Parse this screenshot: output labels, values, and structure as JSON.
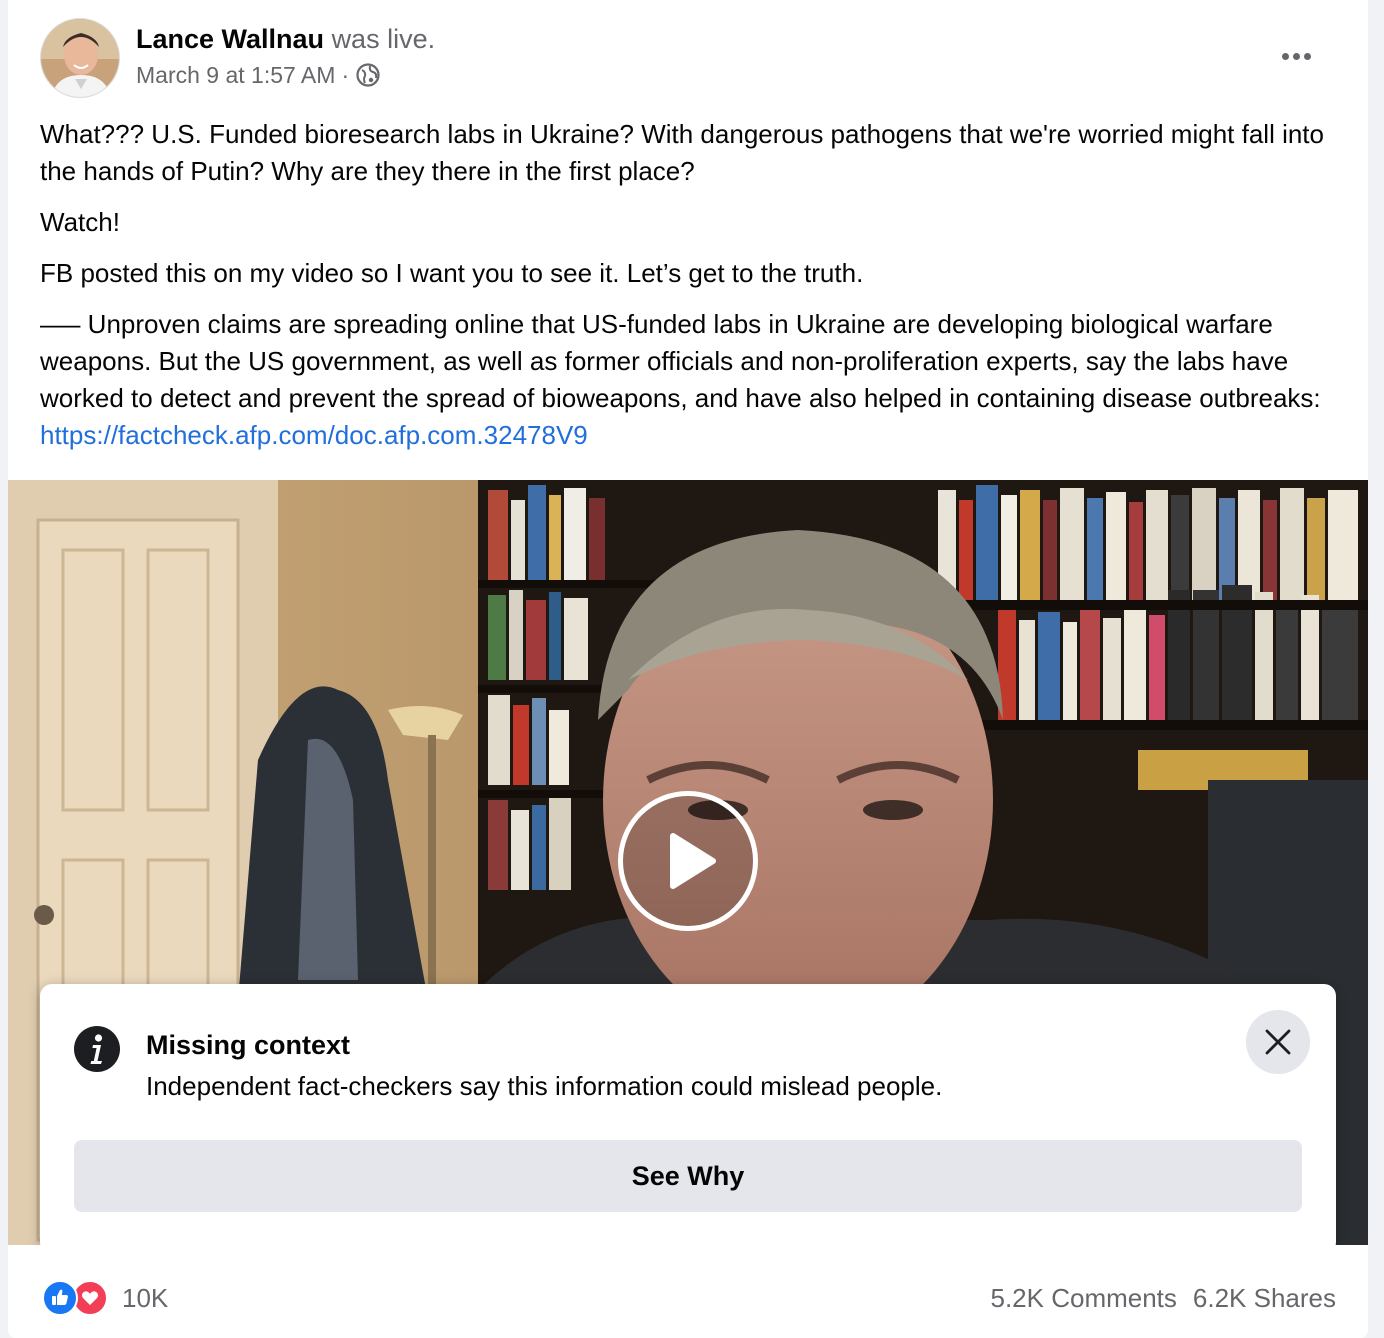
{
  "header": {
    "author_name": "Lance Wallnau",
    "author_status": "was live.",
    "timestamp": "March 9 at 1:57 AM",
    "separator": "·",
    "audience_icon": "globe-icon",
    "more_icon": "more-dots-icon"
  },
  "post_text": {
    "paragraph_1": "What??? U.S. Funded bioresearch labs in Ukraine? With dangerous pathogens that we're worried might fall into the hands of Putin? Why are they there in the first place?",
    "paragraph_2": "Watch!",
    "paragraph_3": "FB posted this on my video so I want you to see it. Let’s get to the truth.",
    "paragraph_4": "—– Unproven claims are spreading online that US-funded labs in Ukraine are developing biological warfare weapons. But the US government, as well as former officials and non-proliferation experts, say the labs have worked to detect and prevent the spread of bioweapons, and have also helped in containing disease outbreaks: ",
    "link": "https://factcheck.afp.com/doc.afp.com.32478V9"
  },
  "video": {
    "play_icon": "play-icon"
  },
  "fact_check": {
    "info_icon": "info-icon",
    "title": "Missing context",
    "description": "Independent fact-checkers say this information could mislead people.",
    "close_icon": "close-icon",
    "button_label": "See Why"
  },
  "footer": {
    "reaction_icons": [
      "like-icon",
      "love-icon"
    ],
    "reaction_count": "10K",
    "comments": "5.2K Comments",
    "shares": "6.2K Shares"
  },
  "colors": {
    "link": "#216fdb",
    "like": "#1877f2",
    "love": "#f33e58",
    "secondary_text": "#65676b",
    "button_bg": "#e4e6eb"
  }
}
